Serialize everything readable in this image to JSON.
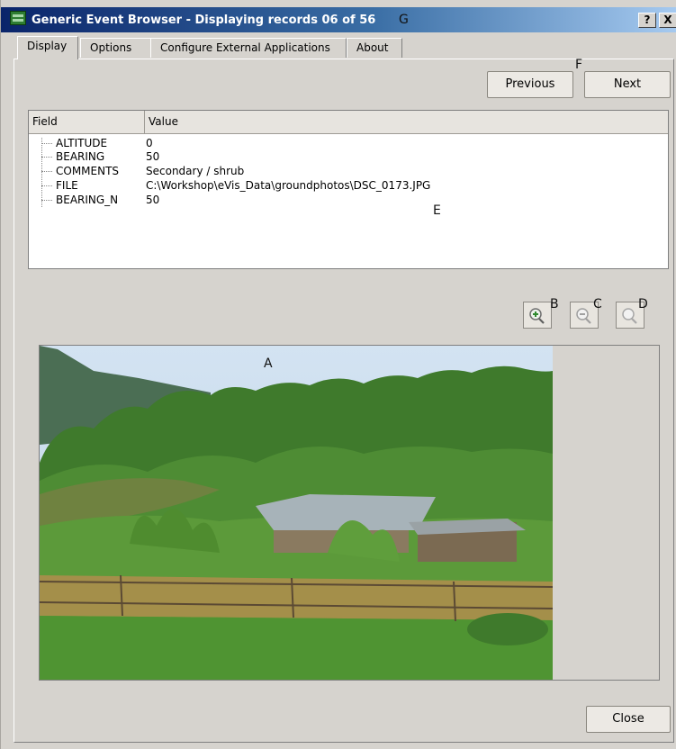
{
  "window": {
    "title": "Generic Event Browser - Displaying records 06 of 56"
  },
  "annotations": {
    "a": "A",
    "b": "B",
    "c": "C",
    "d": "D",
    "e": "E",
    "f": "F",
    "g": "G"
  },
  "titlebar_buttons": {
    "help": "?",
    "close": "X"
  },
  "tabs": [
    {
      "label": "Display",
      "active": true
    },
    {
      "label": "Options",
      "active": false
    },
    {
      "label": "Configure External Applications",
      "active": false
    },
    {
      "label": "About",
      "active": false
    }
  ],
  "nav": {
    "previous": "Previous",
    "next": "Next"
  },
  "table": {
    "columns": [
      "Field",
      "Value"
    ],
    "rows": [
      {
        "field": "ALTITUDE",
        "value": "0"
      },
      {
        "field": "BEARING",
        "value": "50"
      },
      {
        "field": "COMMENTS",
        "value": "Secondary / shrub"
      },
      {
        "field": "FILE",
        "value": "C:\\Workshop\\eVis_Data\\groundphotos\\DSC_0173.JPG"
      },
      {
        "field": "BEARING_N",
        "value": "50"
      }
    ]
  },
  "zoom_buttons": [
    "zoom-in-icon",
    "zoom-out-icon",
    "zoom-full-icon"
  ],
  "footer": {
    "close": "Close"
  }
}
